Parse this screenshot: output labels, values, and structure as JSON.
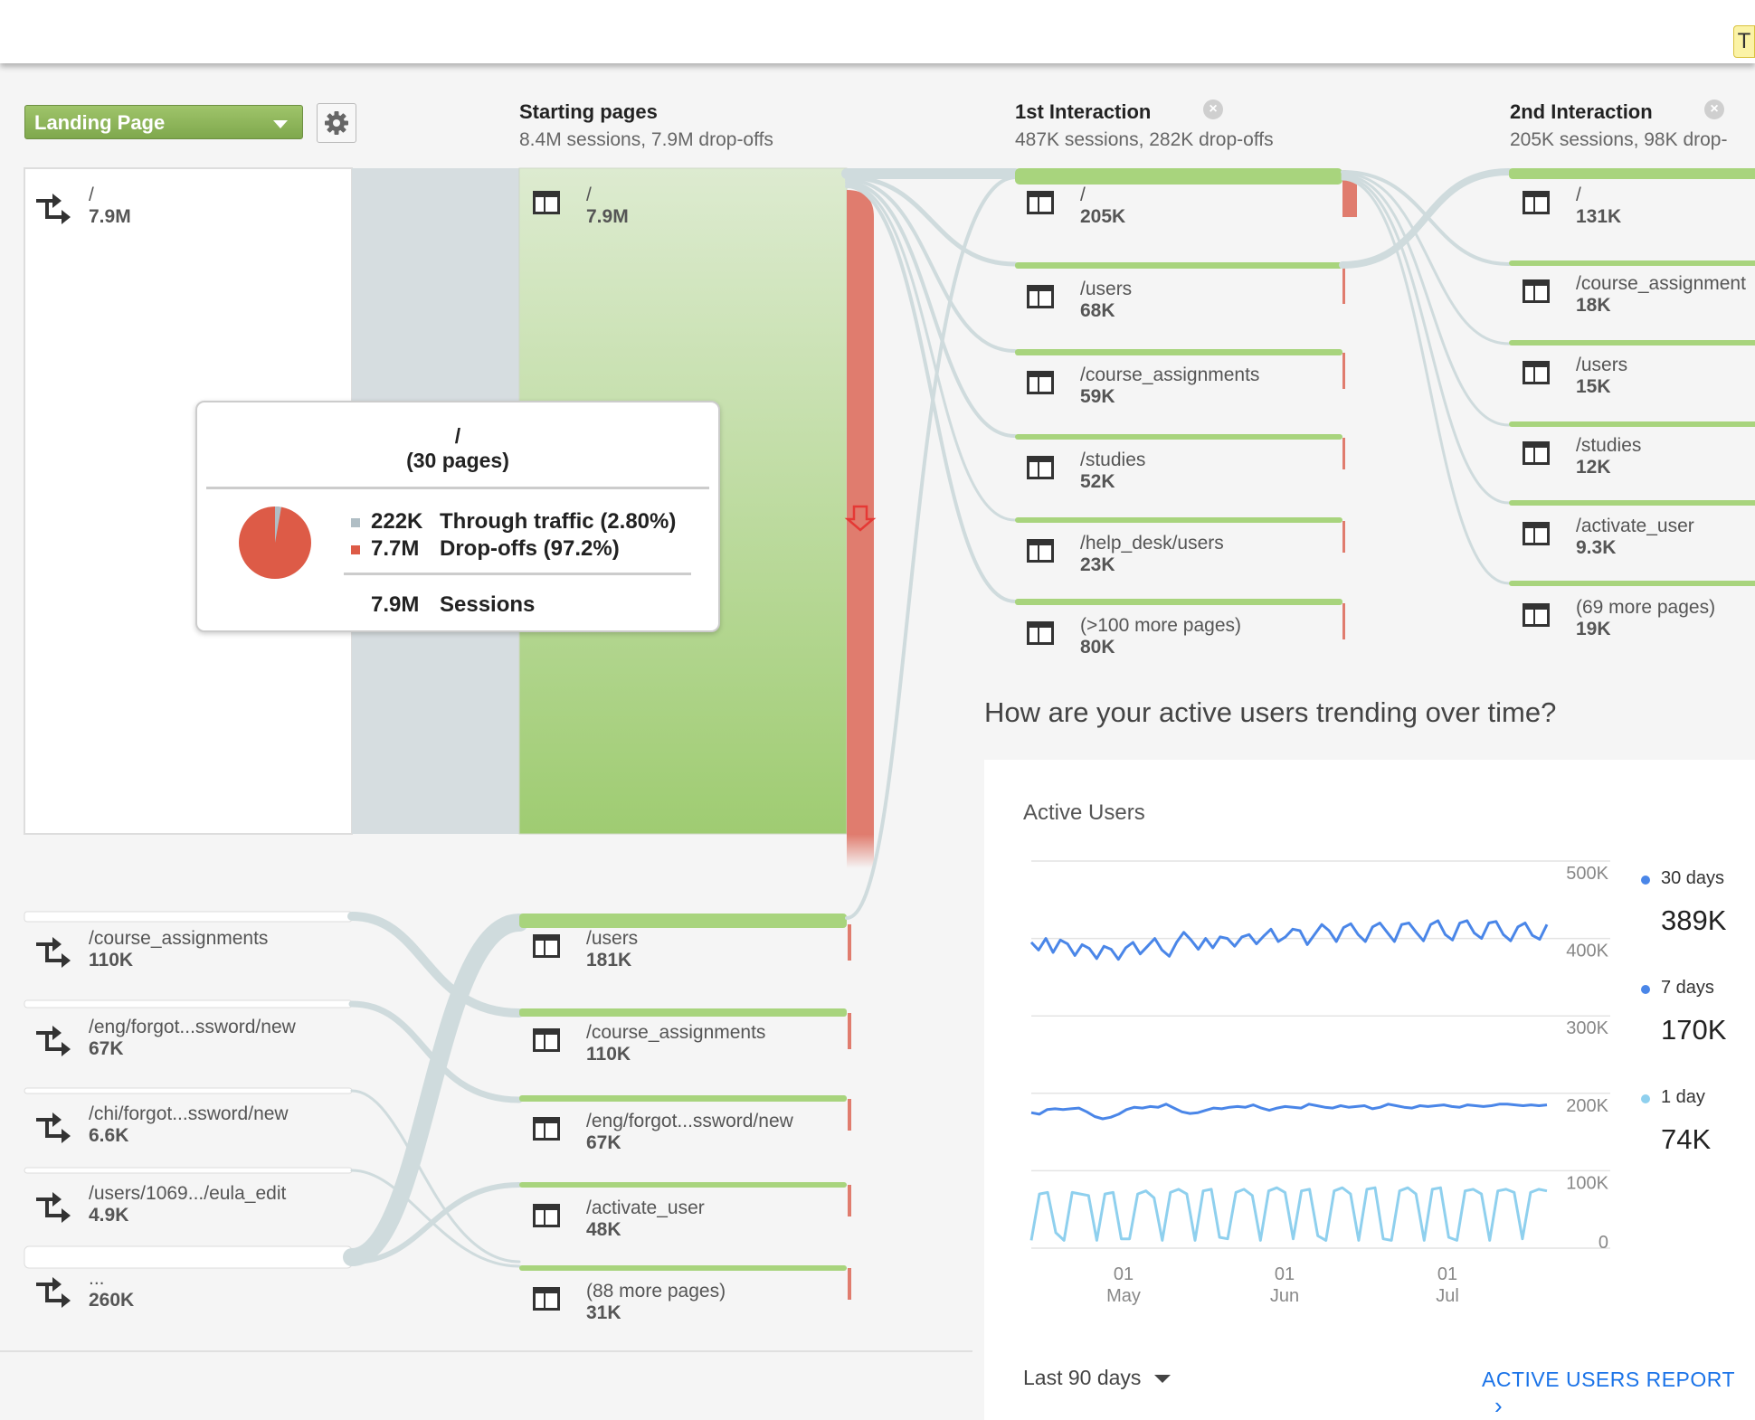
{
  "topbar": {
    "tag": "T"
  },
  "controls": {
    "dimension_label": "Landing Page"
  },
  "columns": {
    "landing": {
      "nodes": [
        {
          "name": "/",
          "value": "7.9M"
        },
        {
          "name": "/course_assignments",
          "value": "110K"
        },
        {
          "name": "/eng/forgot...ssword/new",
          "value": "67K"
        },
        {
          "name": "/chi/forgot...ssword/new",
          "value": "6.6K"
        },
        {
          "name": "/users/1069.../eula_edit",
          "value": "4.9K"
        },
        {
          "name": "...",
          "value": "260K"
        }
      ]
    },
    "starting": {
      "title": "Starting pages",
      "subtitle": "8.4M sessions, 7.9M drop-offs",
      "nodes": [
        {
          "name": "/",
          "value": "7.9M"
        },
        {
          "name": "/users",
          "value": "181K"
        },
        {
          "name": "/course_assignments",
          "value": "110K"
        },
        {
          "name": "/eng/forgot...ssword/new",
          "value": "67K"
        },
        {
          "name": "/activate_user",
          "value": "48K"
        },
        {
          "name": "(88 more pages)",
          "value": "31K"
        }
      ]
    },
    "first": {
      "title": "1st Interaction",
      "subtitle": "487K sessions, 282K drop-offs",
      "nodes": [
        {
          "name": "/",
          "value": "205K"
        },
        {
          "name": "/users",
          "value": "68K"
        },
        {
          "name": "/course_assignments",
          "value": "59K"
        },
        {
          "name": "/studies",
          "value": "52K"
        },
        {
          "name": "/help_desk/users",
          "value": "23K"
        },
        {
          "name": "(>100 more pages)",
          "value": "80K"
        }
      ]
    },
    "second": {
      "title": "2nd Interaction",
      "subtitle": "205K sessions, 98K drop-",
      "nodes": [
        {
          "name": "/",
          "value": "131K"
        },
        {
          "name": "/course_assignment",
          "value": "18K"
        },
        {
          "name": "/users",
          "value": "15K"
        },
        {
          "name": "/studies",
          "value": "12K"
        },
        {
          "name": "/activate_user",
          "value": "9.3K"
        },
        {
          "name": "(69 more pages)",
          "value": "19K"
        }
      ]
    }
  },
  "tooltip": {
    "title_line1": "/",
    "title_line2": "(30 pages)",
    "through_value": "222K",
    "through_label": "Through traffic (2.80%)",
    "dropoff_value": "7.7M",
    "dropoff_label": "Drop-offs (97.2%)",
    "sessions_value": "7.9M",
    "sessions_label": "Sessions",
    "through_fraction": 0.028,
    "colors": {
      "through": "#b0bec5",
      "dropoff": "#dd5b47"
    }
  },
  "active_users": {
    "question": "How are your active users trending over time?",
    "card_title": "Active Users",
    "legend": [
      {
        "name": "30 days",
        "value": "389K",
        "color": "#4a86e8"
      },
      {
        "name": "7 days",
        "value": "170K",
        "color": "#4a86e8"
      },
      {
        "name": "1 day",
        "value": "74K",
        "color": "#8fd0ee"
      }
    ],
    "footer_range": "Last 90 days",
    "footer_link": "ACTIVE USERS REPORT"
  },
  "chart_data": {
    "type": "line",
    "title": "Active Users",
    "y_ticks": [
      "500K",
      "400K",
      "300K",
      "200K",
      "100K",
      "0"
    ],
    "ylim": [
      0,
      500000
    ],
    "x_ticks": [
      {
        "day": "01",
        "month": "May"
      },
      {
        "day": "01",
        "month": "Jun"
      },
      {
        "day": "01",
        "month": "Jul"
      }
    ],
    "series": [
      {
        "name": "30 days",
        "color": "#4a86e8",
        "values": [
          395000,
          385000,
          400000,
          382000,
          398000,
          393000,
          378000,
          392000,
          387000,
          374000,
          390000,
          386000,
          373000,
          388000,
          395000,
          380000,
          390000,
          400000,
          385000,
          377000,
          395000,
          408000,
          398000,
          386000,
          400000,
          388000,
          402000,
          400000,
          390000,
          402000,
          405000,
          393000,
          403000,
          412000,
          396000,
          402000,
          412000,
          410000,
          392000,
          405000,
          418000,
          410000,
          396000,
          414000,
          419000,
          405000,
          396000,
          415000,
          420000,
          408000,
          396000,
          418000,
          420000,
          408000,
          397000,
          418000,
          423000,
          405000,
          398000,
          420000,
          423000,
          407000,
          400000,
          420000,
          422000,
          405000,
          397000,
          415000,
          420000,
          404000,
          399000,
          418000
        ]
      },
      {
        "name": "7 days",
        "color": "#4a86e8",
        "values": [
          175000,
          173000,
          179000,
          180000,
          179000,
          180000,
          181000,
          176000,
          170000,
          167000,
          169000,
          173000,
          179000,
          182000,
          181000,
          183000,
          182000,
          186000,
          181000,
          176000,
          174000,
          175000,
          178000,
          181000,
          180000,
          182000,
          183000,
          182000,
          185000,
          181000,
          178000,
          181000,
          183000,
          182000,
          181000,
          186000,
          184000,
          182000,
          181000,
          184000,
          182000,
          183000,
          184000,
          180000,
          182000,
          186000,
          184000,
          182000,
          181000,
          184000,
          183000,
          184000,
          185000,
          183000,
          182000,
          185000,
          184000,
          183000,
          184000,
          186000,
          186000,
          185000,
          184000,
          185000,
          184000,
          185000
        ]
      },
      {
        "name": "1 day",
        "color": "#8fd0ee",
        "values": [
          10000,
          70000,
          72000,
          20000,
          10000,
          72000,
          70000,
          68000,
          10000,
          70000,
          72000,
          12000,
          12000,
          70000,
          74000,
          65000,
          10000,
          72000,
          76000,
          70000,
          10000,
          74000,
          76000,
          14000,
          12000,
          72000,
          76000,
          68000,
          10000,
          74000,
          78000,
          72000,
          12000,
          74000,
          76000,
          16000,
          10000,
          74000,
          78000,
          70000,
          10000,
          76000,
          78000,
          12000,
          10000,
          74000,
          78000,
          70000,
          10000,
          76000,
          78000,
          14000,
          10000,
          74000,
          76000,
          70000,
          10000,
          74000,
          76000,
          72000,
          12000,
          72000,
          76000,
          74000
        ]
      }
    ]
  }
}
